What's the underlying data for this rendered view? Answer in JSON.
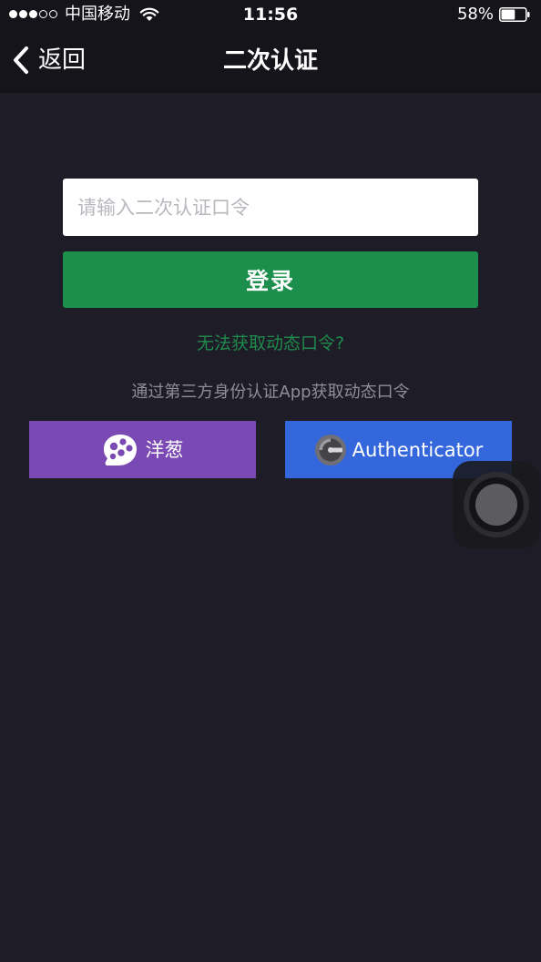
{
  "status_bar": {
    "carrier": "中国移动",
    "time": "11:56",
    "battery_percent": "58%",
    "battery_level": 0.58,
    "signal_bars_filled": 3,
    "signal_bars_total": 5
  },
  "nav": {
    "back_label": "返回",
    "title": "二次认证"
  },
  "form": {
    "code_placeholder": "请输入二次认证口令",
    "code_value": "",
    "login_label": "登录",
    "help_link": "无法获取动态口令?",
    "third_party_hint": "通过第三方身份认证App获取动态口令"
  },
  "apps": {
    "yangcong_label": "洋葱",
    "authenticator_label": "Authenticator"
  },
  "colors": {
    "background": "#1e1d27",
    "login_green": "#1d8f4d",
    "yangcong_purple": "#7b49b3",
    "authenticator_blue": "#3466dc",
    "link_green": "#1f8a4b"
  }
}
